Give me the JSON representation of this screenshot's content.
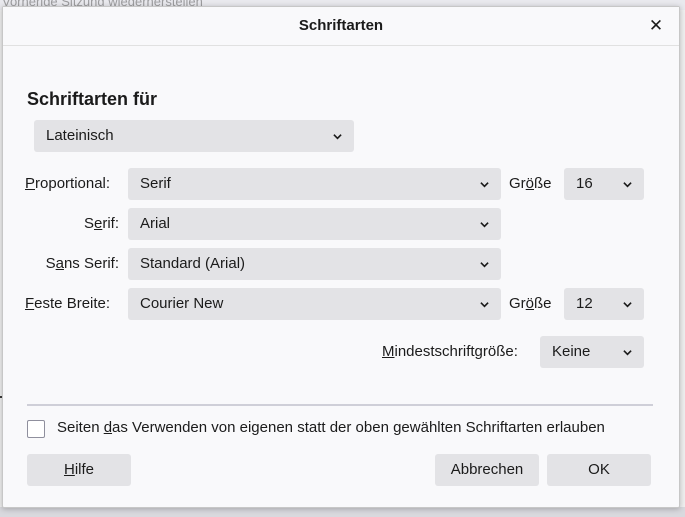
{
  "background": {
    "title_fragment": "Vorherige Sitzung wiederherstellen"
  },
  "dialog": {
    "title": "Schriftarten",
    "close_icon": "close-icon",
    "heading": "Schriftarten für",
    "script_select": {
      "value": "Lateinisch"
    },
    "rows": {
      "proportional": {
        "label_first": "P",
        "label_rest": "roportional:",
        "value": "Serif",
        "size_label_pre": "Gr",
        "size_label_u": "ö",
        "size_label_post": "ße",
        "size_value": "16"
      },
      "serif": {
        "label_pre": "S",
        "label_u": "e",
        "label_post": "rif:",
        "value": "Arial"
      },
      "sans_serif": {
        "label_pre": "S",
        "label_u": "a",
        "label_post": "ns Serif:",
        "value": "Standard (Arial)"
      },
      "monospace": {
        "label_first": "F",
        "label_rest": "este Breite:",
        "value": "Courier New",
        "size_label_pre": "Gr",
        "size_label_u": "ö",
        "size_label_post": "ße",
        "size_value": "12"
      }
    },
    "min_size": {
      "label_first": "M",
      "label_rest": "indestschriftgröße:",
      "value": "Keine"
    },
    "allow_pages": {
      "label_pre": "Seiten ",
      "label_u": "d",
      "label_post": "as Verwenden von eigenen statt der oben gewählten Schriftarten erlauben",
      "checked": false
    },
    "buttons": {
      "help_first": "H",
      "help_rest": "ilfe",
      "cancel": "Abbrechen",
      "ok": "OK"
    }
  },
  "colors": {
    "dialog_bg": "#f9f9fb",
    "control_bg": "#e3e3e6",
    "text": "#1b1b1b"
  }
}
